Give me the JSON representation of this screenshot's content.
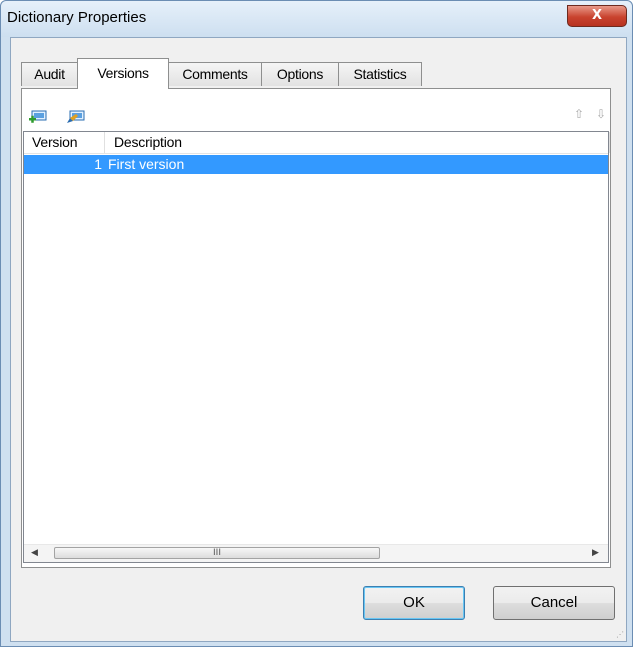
{
  "window": {
    "title": "Dictionary Properties",
    "close_symbol": "X"
  },
  "tabs": [
    {
      "label": "Audit",
      "active": false
    },
    {
      "label": "Versions",
      "active": true
    },
    {
      "label": "Comments",
      "active": false
    },
    {
      "label": "Options",
      "active": false
    },
    {
      "label": "Statistics",
      "active": false
    }
  ],
  "toolbar": {
    "icons": [
      "add-version-icon",
      "edit-version-icon"
    ],
    "move_up_symbol": "⇧",
    "move_down_symbol": "⇩"
  },
  "table": {
    "columns": [
      "Version",
      "Description"
    ],
    "rows": [
      {
        "version": "1",
        "description": "First version",
        "selected": true
      }
    ]
  },
  "scrollbar": {
    "left_symbol": "◀",
    "right_symbol": "▶",
    "thumb_grip": "III"
  },
  "buttons": {
    "ok": "OK",
    "cancel": "Cancel"
  },
  "colors": {
    "selection": "#3399ff",
    "title_bar": "#dbe8f5",
    "close_button": "#c9432f"
  }
}
